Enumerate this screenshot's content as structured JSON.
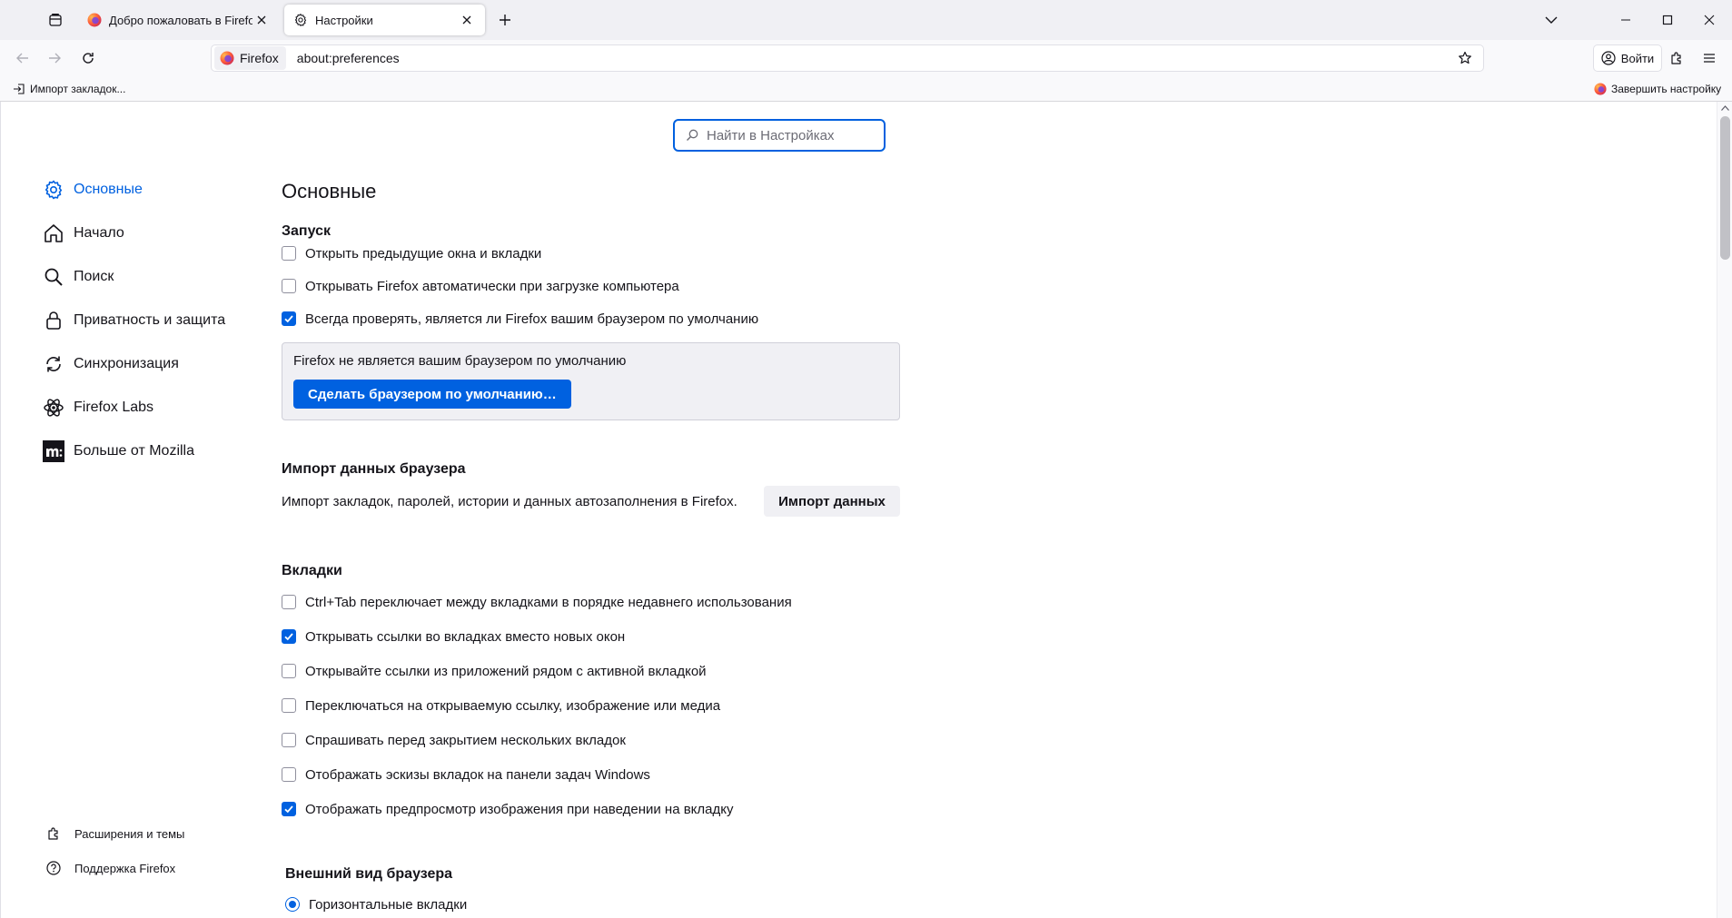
{
  "browser": {
    "tabs": [
      {
        "title": "Добро пожаловать в Firefox",
        "active": false
      },
      {
        "title": "Настройки",
        "active": true
      }
    ],
    "identity_label": "Firefox",
    "url": "about:preferences",
    "login_label": "Войти",
    "bookmarks": {
      "import_label": "Импорт закладок...",
      "finish_setup_label": "Завершить настройку"
    }
  },
  "settings": {
    "search_placeholder": "Найти в Настройках",
    "nav": {
      "items": [
        {
          "label": "Основные",
          "icon": "gear-icon",
          "selected": true
        },
        {
          "label": "Начало",
          "icon": "home-icon"
        },
        {
          "label": "Поиск",
          "icon": "search-icon"
        },
        {
          "label": "Приватность и защита",
          "icon": "lock-icon"
        },
        {
          "label": "Синхронизация",
          "icon": "sync-icon"
        },
        {
          "label": "Firefox Labs",
          "icon": "labs-icon"
        },
        {
          "label": "Больше от Mozilla",
          "icon": "mozilla-icon"
        }
      ],
      "footer": [
        {
          "label": "Расширения и темы",
          "icon": "puzzle-icon"
        },
        {
          "label": "Поддержка Firefox",
          "icon": "help-icon"
        }
      ]
    },
    "page_title": "Основные",
    "startup": {
      "title": "Запуск",
      "options": [
        {
          "label": "Открыть предыдущие окна и вкладки",
          "checked": false
        },
        {
          "label": "Открывать Firefox автоматически при загрузке компьютера",
          "checked": false
        },
        {
          "label": "Всегда проверять, является ли Firefox вашим браузером по умолчанию",
          "checked": true
        }
      ],
      "default_notice": "Firefox не является вашим браузером по умолчанию",
      "make_default_button": "Сделать браузером по умолчанию…"
    },
    "import": {
      "title": "Импорт данных браузера",
      "description": "Импорт закладок, паролей, истории и данных автозаполнения в Firefox.",
      "button": "Импорт данных"
    },
    "tabs_section": {
      "title": "Вкладки",
      "options": [
        {
          "label": "Ctrl+Tab переключает между вкладками в порядке недавнего использования",
          "checked": false
        },
        {
          "label": "Открывать ссылки во вкладках вместо новых окон",
          "checked": true
        },
        {
          "label": "Открывайте ссылки из приложений рядом с активной вкладкой",
          "checked": false
        },
        {
          "label": "Переключаться на открываемую ссылку, изображение или медиа",
          "checked": false
        },
        {
          "label": "Спрашивать перед закрытием нескольких вкладок",
          "checked": false
        },
        {
          "label": "Отображать эскизы вкладок на панели задач Windows",
          "checked": false
        },
        {
          "label": "Отображать предпросмотр изображения при наведении на вкладку",
          "checked": true
        }
      ]
    },
    "appearance": {
      "title": "Внешний вид браузера",
      "options": [
        {
          "label": "Горизонтальные вкладки",
          "selected": true
        }
      ]
    }
  },
  "colors": {
    "accent": "#0061e0",
    "tabstrip_bg": "#f0f0f4",
    "toolbar_bg": "#f9f9fb"
  }
}
